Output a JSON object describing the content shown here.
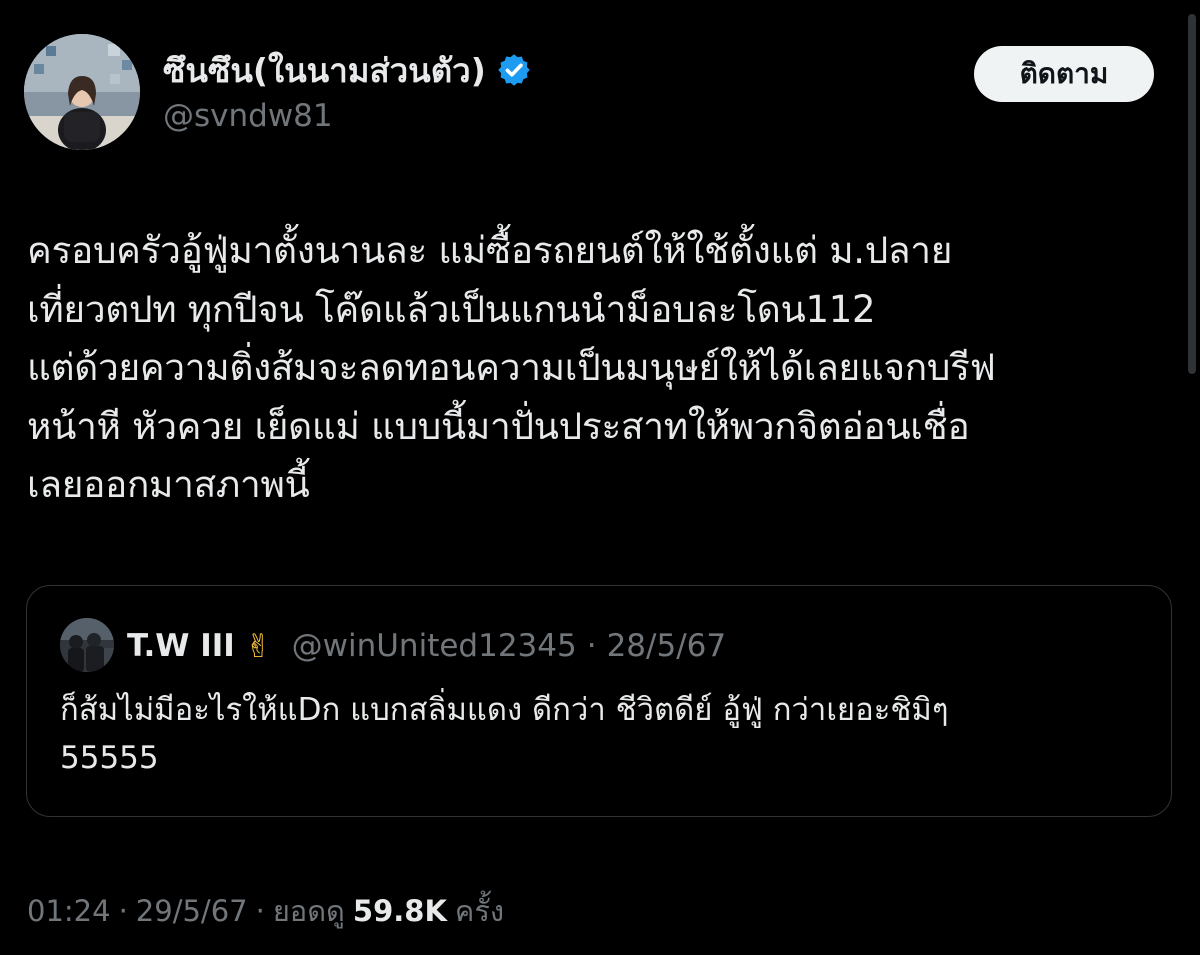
{
  "author": {
    "display_name": "ซึนซึน(ในนามส่วนตัว)",
    "handle": "@svndw81",
    "avatar_icon": "profile-photo",
    "verified_icon": "verified-badge-icon",
    "verified_color": "#1d9bf0"
  },
  "follow_button": {
    "label": "ติดตาม"
  },
  "tweet": {
    "lines": [
      "ครอบครัวอู้ฟู่มาตั้งนานละ แม่ซื้อรถยนต์ให้ใช้ตั้งแต่ ม.ปลาย",
      "เที่ยวตปท ทุกปีจน โค๊ดแล้วเป็นแกนนำม็อบละโดน112",
      "แต่ด้วยความติ่งส้มจะลดทอนความเป็นมนุษย์ให้ได้เลยแจกบรีฟ",
      "หน้าหี หัวควย เย็ดแม่ แบบนี้มาปั่นประสาทให้พวกจิตอ่อนเชื่อ",
      "เลยออกมาสภาพนี้"
    ]
  },
  "quote": {
    "author_name": "T.W III",
    "emoji": "✌",
    "handle": "@winUnited12345",
    "separator": "·",
    "date": "28/5/67",
    "lines": [
      "ก็ส้มไม่มีอะไรให้แDก แบกสลิ่มแดง ดีกว่า  ชีวิตดีย์ อู้ฟู่ กว่าเยอะชิมิๆ",
      "55555"
    ]
  },
  "meta": {
    "time": "01:24",
    "separator": "·",
    "date": "29/5/67",
    "views_label": "ยอดดู",
    "views_count": "59.8K",
    "views_suffix": "ครั้ง"
  },
  "colors": {
    "background": "#000000",
    "text_primary": "#e7e9ea",
    "text_muted": "#71767b",
    "border": "#2f3336",
    "follow_bg": "#eff3f4"
  }
}
